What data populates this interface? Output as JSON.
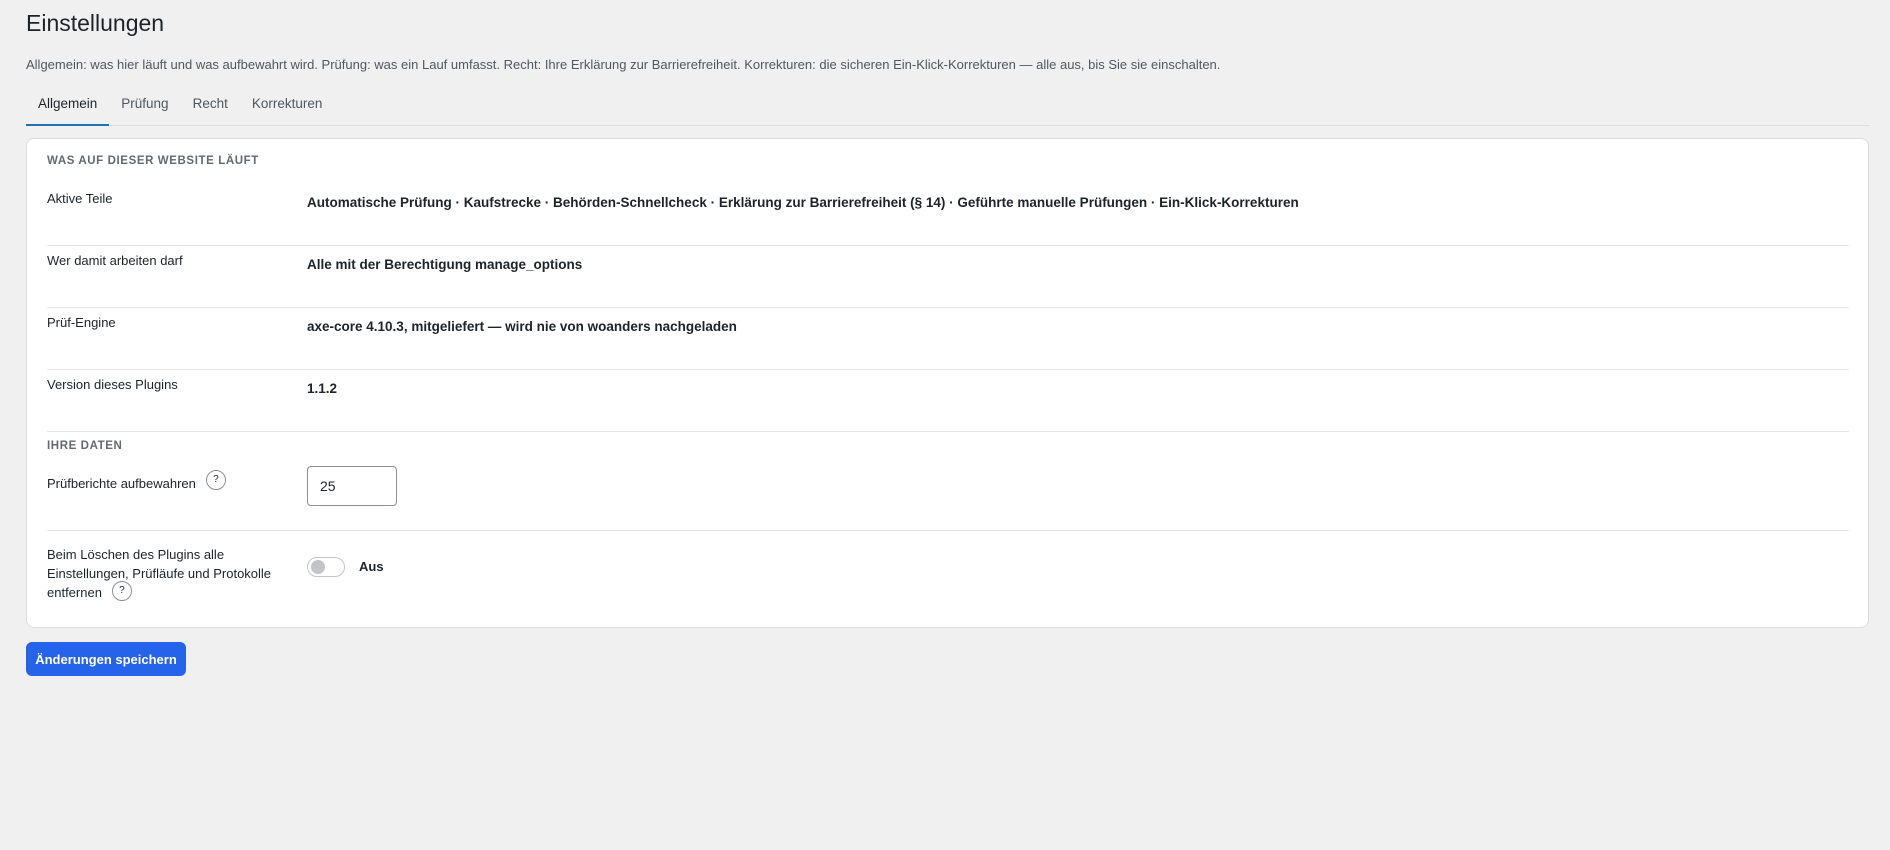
{
  "page": {
    "title": "Einstellungen",
    "description": "Allgemein: was hier läuft und was aufbewahrt wird. Prüfung: was ein Lauf umfasst. Recht: Ihre Erklärung zur Barrierefreiheit. Korrekturen: die sicheren Ein-Klick-Korrekturen — alle aus, bis Sie sie einschalten."
  },
  "tabs": [
    {
      "label": "Allgemein",
      "active": true
    },
    {
      "label": "Prüfung",
      "active": false
    },
    {
      "label": "Recht",
      "active": false
    },
    {
      "label": "Korrekturen",
      "active": false
    }
  ],
  "site_section": {
    "heading": "Was auf dieser Website läuft",
    "rows": [
      {
        "label": "Aktive Teile",
        "value": "Automatische Prüfung · Kaufstrecke · Behörden-Schnellcheck · Erklärung zur Barrierefreiheit (§ 14) · Geführte manuelle Prüfungen · Ein-Klick-Korrekturen"
      },
      {
        "label": "Wer damit arbeiten darf",
        "value": "Alle mit der Berechtigung manage_options"
      },
      {
        "label": "Prüf-Engine",
        "value": "axe-core 4.10.3, mitgeliefert — wird nie von woanders nachgeladen"
      },
      {
        "label": "Version dieses Plugins",
        "value": "1.1.2"
      }
    ]
  },
  "data_section": {
    "heading": "Ihre Daten",
    "retention": {
      "label": "Prüfberichte aufbewahren",
      "help": "?",
      "value": "25"
    },
    "delete_on_uninstall": {
      "label": "Beim Löschen des Plugins alle Einstellungen, Prüfläufe und Protokolle entfernen",
      "help": "?",
      "enabled": false,
      "state_label": "Aus"
    }
  },
  "actions": {
    "save_label": "Änderungen speichern"
  },
  "colors": {
    "accent": "#2271b1",
    "button": "#2563eb",
    "background": "#f0f0f1"
  }
}
